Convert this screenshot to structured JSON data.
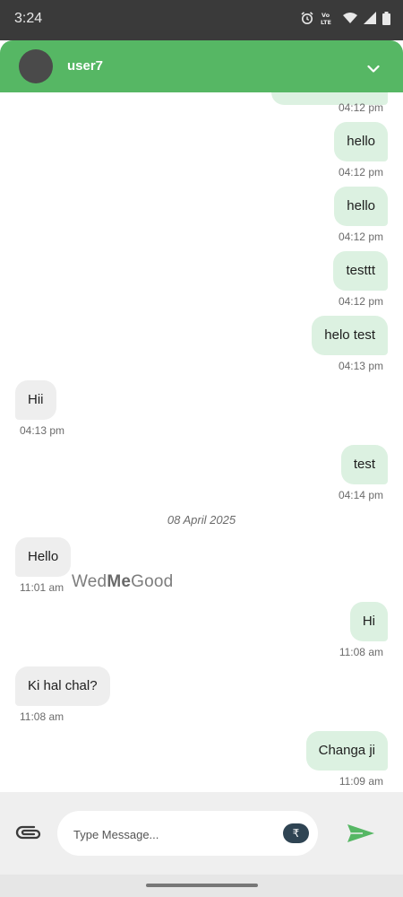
{
  "status_bar": {
    "time": "3:24",
    "icons": [
      "alarm-icon",
      "volte-lte-icon",
      "wifi-icon",
      "signal-icon",
      "battery-icon"
    ],
    "lte_label": "Vo LTE"
  },
  "header": {
    "username": "user7",
    "color": "#56b764"
  },
  "messages": [
    {
      "type": "sent",
      "text": "",
      "time": "04:12 pm"
    },
    {
      "type": "sent",
      "text": "hello",
      "time": "04:12 pm"
    },
    {
      "type": "sent",
      "text": "hello",
      "time": "04:12 pm"
    },
    {
      "type": "sent",
      "text": "testtt",
      "time": "04:12 pm"
    },
    {
      "type": "sent",
      "text": "helo test",
      "time": "04:13 pm"
    },
    {
      "type": "received",
      "text": "Hii",
      "time": "04:13 pm"
    },
    {
      "type": "sent",
      "text": "test",
      "time": "04:14 pm"
    },
    {
      "type": "date",
      "text": "08 April 2025"
    },
    {
      "type": "received",
      "text": "Hello",
      "time": "11:01 am"
    },
    {
      "type": "sent",
      "text": "Hi",
      "time": "11:08 am"
    },
    {
      "type": "received",
      "text": "Ki hal chal?",
      "time": "11:08 am"
    },
    {
      "type": "sent",
      "text": "Changa ji",
      "time": "11:09 am"
    }
  ],
  "watermark": {
    "part1": "Wed",
    "part2": "Me",
    "part3": "Good"
  },
  "input_bar": {
    "placeholder": "Type Message...",
    "currency_symbol": "₹"
  },
  "colors": {
    "sent_bubble": "#dcf1e1",
    "received_bubble": "#eeeeee",
    "send_icon": "#56b764"
  }
}
